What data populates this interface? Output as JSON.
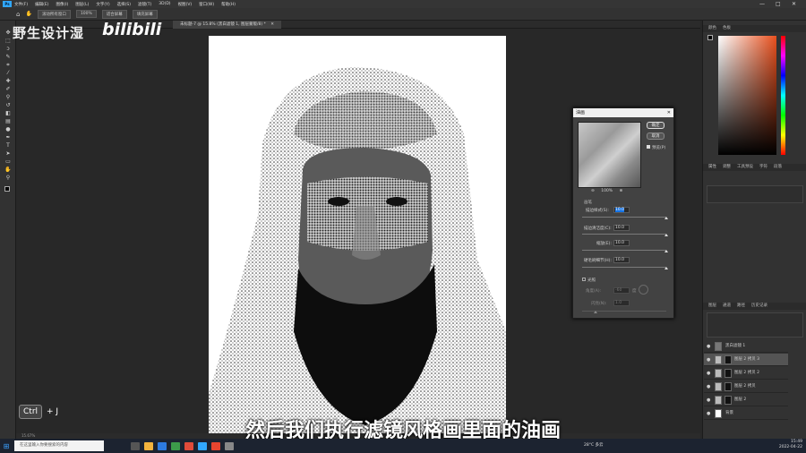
{
  "menubar": {
    "app_badge": "Ps",
    "items": [
      "文件(F)",
      "编辑(E)",
      "图像(I)",
      "图层(L)",
      "文字(Y)",
      "选择(S)",
      "滤镜(T)",
      "3D(D)",
      "视图(V)",
      "窗口(W)",
      "帮助(H)"
    ],
    "minimize": "—",
    "maximize": "□",
    "close": "✕"
  },
  "options_bar": {
    "home": "⌂",
    "tool": "✋",
    "buttons": [
      "滚动所有窗口",
      "100%",
      "适合屏幕",
      "填充屏幕"
    ]
  },
  "document": {
    "tab_title": "未标题-7 @ 15.8% (黑白滤镜 1, 图层蒙版/8) *",
    "tab_close": "✕",
    "status": "15.67%"
  },
  "watermark": {
    "channel_name": "野生设计湿",
    "site_logo": "bilibili"
  },
  "oil_dialog": {
    "title": "油画",
    "close": "✕",
    "ok": "确定",
    "cancel": "取消",
    "preview_label": "预览(P)",
    "preview_checked": true,
    "zoom_out": "⊖",
    "zoom": "100%",
    "zoom_in": "⊕",
    "brush_section": "画笔",
    "params": [
      {
        "label": "描边样式(S):",
        "value": "10.0",
        "level": 1.0,
        "selected": true
      },
      {
        "label": "描边清洁度(C):",
        "value": "10.0",
        "level": 1.0
      },
      {
        "label": "缩放(E):",
        "value": "10.0",
        "level": 1.0
      },
      {
        "label": "硬毛刷细节(H):",
        "value": "10.0",
        "level": 1.0
      }
    ],
    "lighting_section": "光照",
    "lighting_checked": false,
    "angle_label": "角度(A):",
    "angle_value": "-60",
    "angle_unit": "度",
    "gloss_label": "闪亮(N):",
    "gloss_value": "1.0"
  },
  "right_panel": {
    "color_tabs": [
      "颜色",
      "色板"
    ],
    "prop_tabs": [
      "属性",
      "调整",
      "工具预设",
      "字符",
      "段落"
    ],
    "layer_tabs": [
      "图层",
      "通道",
      "路径",
      "历史记录"
    ],
    "layers": [
      {
        "name": "黑白滤镜 1",
        "visible": true,
        "active": false
      },
      {
        "name": "图层 2 拷贝 3",
        "visible": true,
        "active": true
      },
      {
        "name": "图层 2 拷贝 2",
        "visible": true,
        "active": false
      },
      {
        "name": "图层 2 拷贝",
        "visible": true,
        "active": false
      },
      {
        "name": "图层 2",
        "visible": true,
        "active": false
      },
      {
        "name": "背景",
        "visible": true,
        "active": false
      }
    ]
  },
  "overlay": {
    "key_hint_key": "Ctrl",
    "key_hint_rest": "+ J",
    "subtitle": "然后我们执行滤镜风格画里面的油画"
  },
  "taskbar": {
    "search_placeholder": "在这里输入你要搜索的内容",
    "weather": "28°C 多云",
    "time": "15:49",
    "date": "2022-04-22"
  },
  "colors": {
    "accent": "#31a8ff",
    "active_layer": "#545454",
    "dialog_bg": "#424242"
  }
}
